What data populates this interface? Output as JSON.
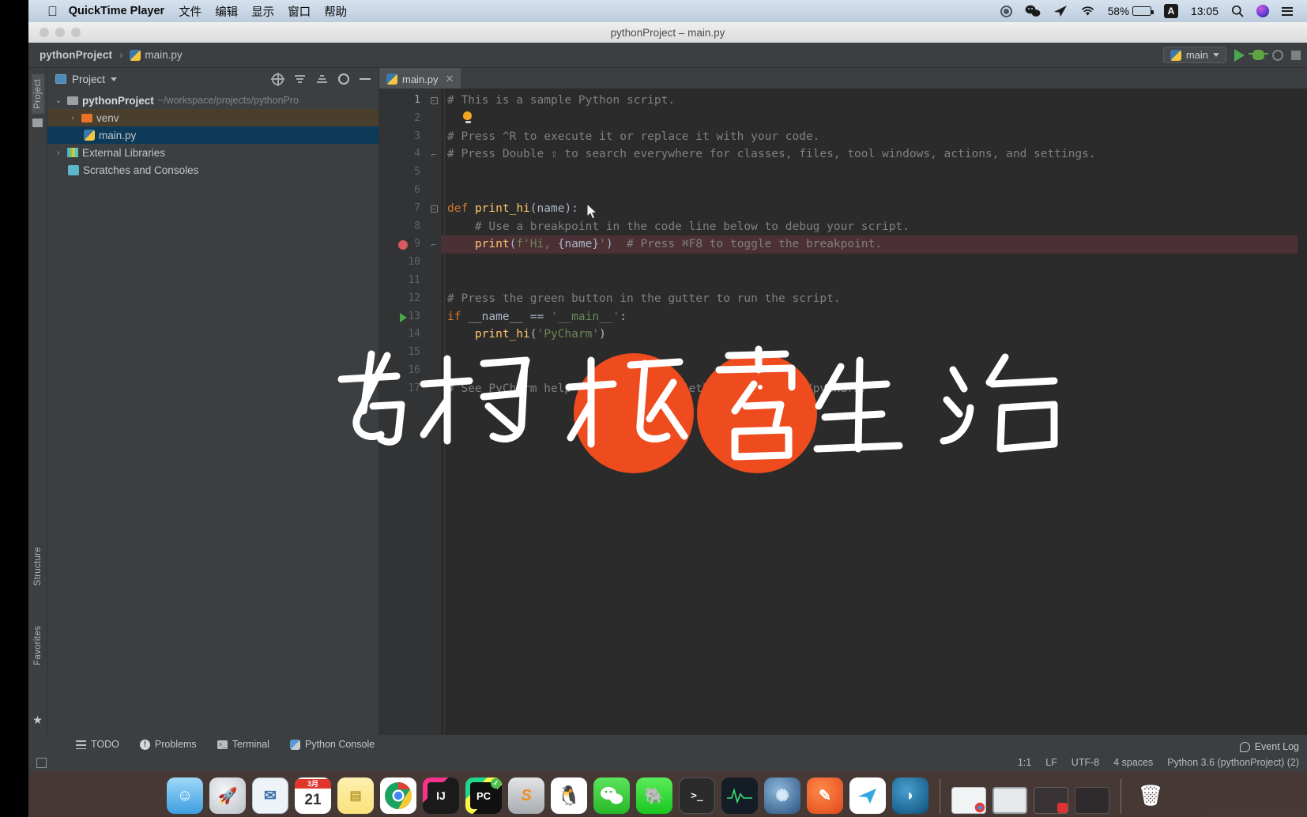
{
  "menubar": {
    "apple_icon": "apple-icon",
    "app_name": "QuickTime Player",
    "items": [
      "文件",
      "编辑",
      "显示",
      "窗口",
      "帮助"
    ],
    "status": {
      "record_icon": "record-icon",
      "wechat_icon": "wechat-icon",
      "telegram_icon": "telegram-icon",
      "wifi_icon": "wifi-icon",
      "battery_percent": "58%",
      "battery_icon": "battery-icon",
      "input_source": "A",
      "clock": "13:05",
      "search_icon": "search-icon",
      "siri_icon": "siri-icon",
      "controlcenter_icon": "list-icon"
    }
  },
  "window": {
    "title": "pythonProject – main.py",
    "traffic_lights": [
      "close",
      "minimize",
      "zoom"
    ]
  },
  "navbar": {
    "project_crumb": "pythonProject",
    "separator": "›",
    "file_crumb": "main.py",
    "run_config": "main",
    "run_icon": "run-icon",
    "debug_icon": "debug-icon",
    "coverage_icon": "coverage-icon",
    "stop_icon": "stop-icon"
  },
  "leftstrip": {
    "project_tab": "Project",
    "structure_tab": "Structure",
    "favorites_tab": "Favorites"
  },
  "project_panel": {
    "header_label": "Project",
    "header_caret": "▾",
    "tools": [
      "target-icon",
      "collapse-icon",
      "expand-icon",
      "gear-icon",
      "minimize-icon"
    ],
    "tree": [
      {
        "label": "pythonProject",
        "path": "~/workspace/projects/pythonPro",
        "arrow": "⌄",
        "icon": "folder-icon",
        "depth": 0,
        "state": "normal"
      },
      {
        "label": "venv",
        "path": "",
        "arrow": "›",
        "icon": "folder-orange-icon",
        "depth": 1,
        "state": "highlighted"
      },
      {
        "label": "main.py",
        "path": "",
        "arrow": "",
        "icon": "python-file-icon",
        "depth": 2,
        "state": "selected"
      },
      {
        "label": "External Libraries",
        "path": "",
        "arrow": "›",
        "icon": "libraries-icon",
        "depth": 0,
        "state": "normal"
      },
      {
        "label": "Scratches and Consoles",
        "path": "",
        "arrow": "",
        "icon": "scratches-icon",
        "depth": 0,
        "state": "normal"
      }
    ]
  },
  "editor": {
    "tab_label": "main.py",
    "tab_icon": "python-file-icon",
    "tab_close": "✕",
    "lines": [
      {
        "n": "1",
        "fold": "minus",
        "marker": "",
        "html": "<span class='cmt'># This is a sample Python script.</span>"
      },
      {
        "n": "2",
        "fold": "",
        "marker": "bulb",
        "html": ""
      },
      {
        "n": "3",
        "fold": "",
        "marker": "",
        "html": "<span class='cmt'># Press ^R to execute it or replace it with your code.</span>"
      },
      {
        "n": "4",
        "fold": "brace",
        "marker": "",
        "html": "<span class='cmt'># Press Double ⇧ to search everywhere for classes, files, tool windows, actions, and settings.</span>"
      },
      {
        "n": "5",
        "fold": "",
        "marker": "",
        "html": ""
      },
      {
        "n": "6",
        "fold": "",
        "marker": "",
        "html": ""
      },
      {
        "n": "7",
        "fold": "minus",
        "marker": "",
        "html": "<span class='kw'>def</span> <span class='fn'>print_hi</span>(<span class='var'>name</span>):"
      },
      {
        "n": "8",
        "fold": "",
        "marker": "",
        "html": "    <span class='cmt'># Use a breakpoint in the code line below to debug your script.</span>"
      },
      {
        "n": "9",
        "fold": "brace",
        "marker": "breakpoint",
        "html": "    <span class='fn'>print</span>(<span class='str'>f'Hi, </span><span class='brace'>{</span><span class='var'>name</span><span class='brace'>}</span><span class='str'>'</span>)  <span class='cmt'># Press ⌘F8 to toggle the breakpoint.</span>"
      },
      {
        "n": "10",
        "fold": "",
        "marker": "",
        "html": ""
      },
      {
        "n": "11",
        "fold": "",
        "marker": "",
        "html": ""
      },
      {
        "n": "12",
        "fold": "",
        "marker": "",
        "html": "<span class='cmt'># Press the green button in the gutter to run the script.</span>"
      },
      {
        "n": "13",
        "fold": "",
        "marker": "runarrow",
        "html": "<span class='kw'>if</span> <span class='var'>__name__</span> == <span class='str'>'__main__'</span>:"
      },
      {
        "n": "14",
        "fold": "",
        "marker": "",
        "html": "    <span class='fn'>print_hi</span>(<span class='str'>'PyCharm'</span>)"
      },
      {
        "n": "15",
        "fold": "",
        "marker": "",
        "html": ""
      },
      {
        "n": "16",
        "fold": "",
        "marker": "",
        "html": ""
      },
      {
        "n": "17",
        "fold": "",
        "marker": "",
        "html": "<span class='cmt'># See PyCharm help at https://www.jetbrains.com/help/pycharm/</span>"
      }
    ]
  },
  "bottom_bar": {
    "items": [
      {
        "label": "TODO",
        "icon": "todo-icon"
      },
      {
        "label": "Problems",
        "icon": "problems-icon"
      },
      {
        "label": "Terminal",
        "icon": "terminal-icon"
      },
      {
        "label": "Python Console",
        "icon": "python-console-icon"
      }
    ]
  },
  "event_log": {
    "label": "Event Log",
    "icon": "event-log-icon"
  },
  "status_bar": {
    "caret": "1:1",
    "line_separator": "LF",
    "encoding": "UTF-8",
    "indent": "4 spaces",
    "interpreter": "Python 3.6 (pythonProject) (2)"
  },
  "watermark": {
    "text": "老 杨 极 客 生 活",
    "accent_color": "#ee4c1e",
    "ink_color": "#ffffff"
  },
  "dock": {
    "items": [
      {
        "name": "finder",
        "glyph": "☺",
        "color": "#37a3e8"
      },
      {
        "name": "launchpad",
        "glyph": "🚀",
        "color": "#d9dde2"
      },
      {
        "name": "mail",
        "glyph": "✉",
        "color": "#e8eef5"
      },
      {
        "name": "calendar",
        "glyph": "21",
        "color": "#ffffff"
      },
      {
        "name": "notes",
        "glyph": "▤",
        "color": "#fdf3c6"
      },
      {
        "name": "chrome",
        "glyph": "◉",
        "color": "#ffffff"
      },
      {
        "name": "intellij-idea",
        "glyph": "IJ",
        "color": "#1a1a1a"
      },
      {
        "name": "pycharm",
        "glyph": "PC",
        "color": "#111111"
      },
      {
        "name": "sublime-text",
        "glyph": "S",
        "color": "#d2d4d6"
      },
      {
        "name": "qq",
        "glyph": "🐧",
        "color": "#ffffff"
      },
      {
        "name": "wechat",
        "glyph": "◖",
        "color": "#3ec73e"
      },
      {
        "name": "evernote",
        "glyph": "🐘",
        "color": "#37d13a"
      },
      {
        "name": "terminal",
        "glyph": "&gt;_",
        "color": "#2b2b2b"
      },
      {
        "name": "activity-monitor",
        "glyph": "∿",
        "color": "#1d2630"
      },
      {
        "name": "system-preferences",
        "glyph": "✺",
        "color": "#5a8fc7"
      },
      {
        "name": "safari",
        "glyph": "🧭",
        "color": "#ef6a32"
      },
      {
        "name": "telegram",
        "glyph": "➤",
        "color": "#ffffff"
      },
      {
        "name": "quicktime-player",
        "glyph": "◗",
        "color": "#0f6fa8"
      }
    ],
    "minimized": [
      {
        "name": "minimized-window-1"
      },
      {
        "name": "minimized-window-2"
      },
      {
        "name": "minimized-window-3"
      },
      {
        "name": "minimized-window-4"
      }
    ],
    "trash": {
      "name": "trash",
      "glyph": "🗑"
    }
  }
}
